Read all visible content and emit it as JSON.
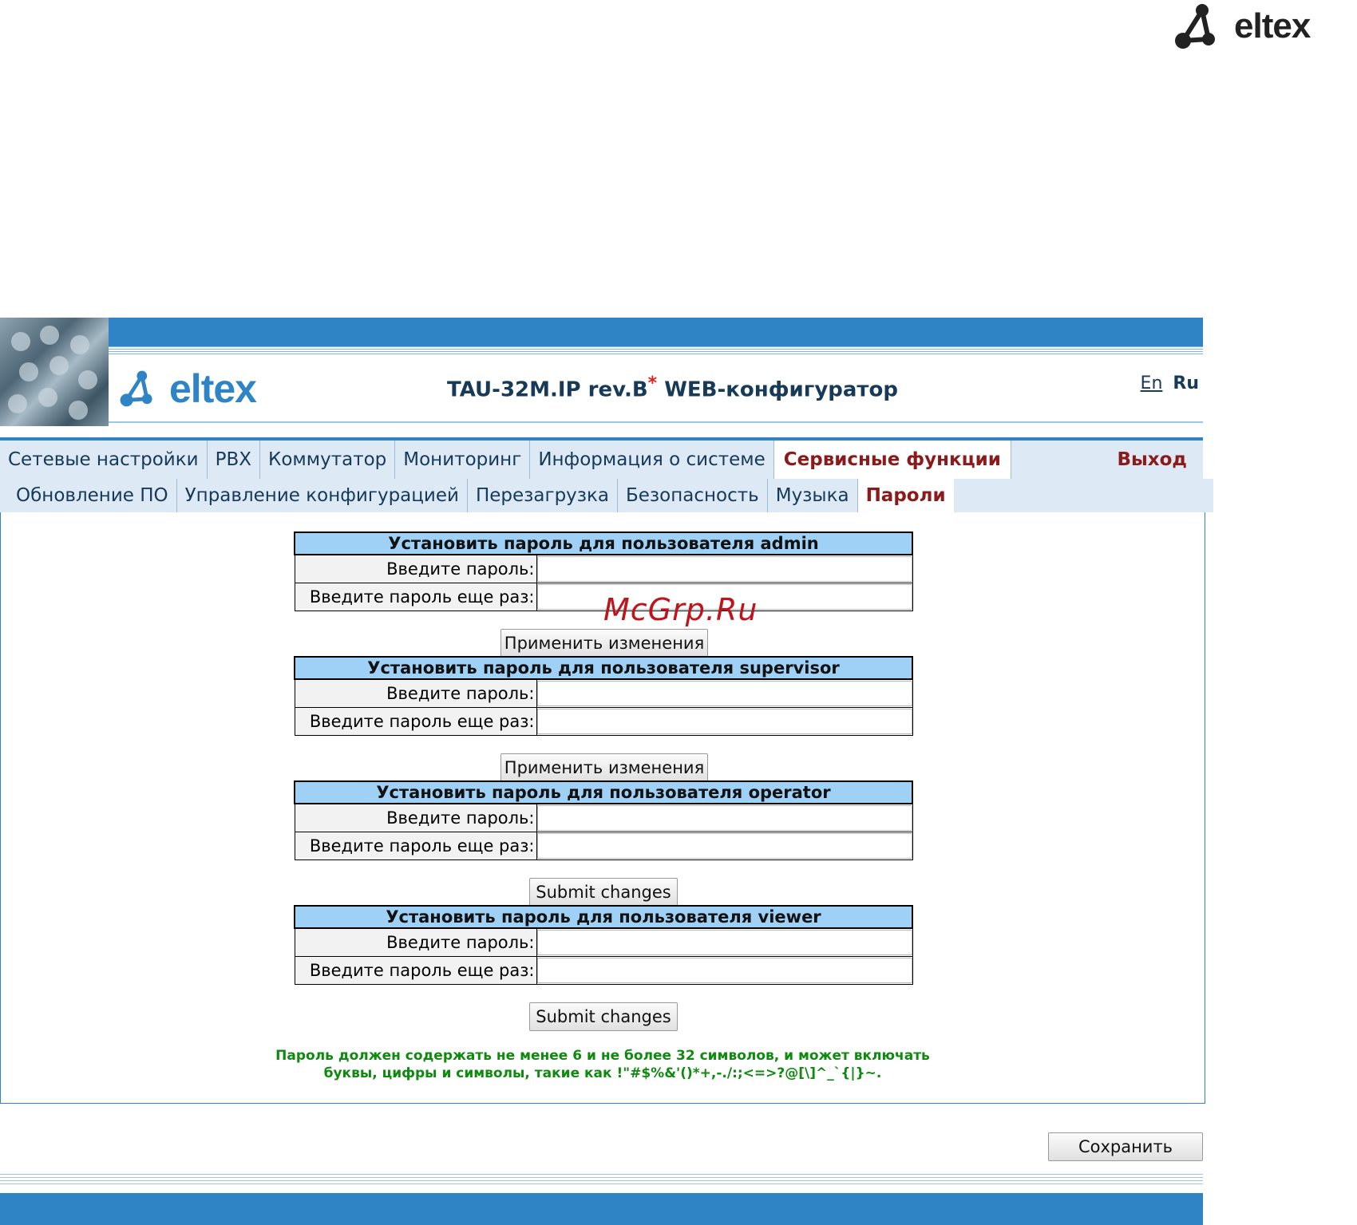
{
  "brand": {
    "corner_logo_text": "eltex",
    "header_logo_text": "eltex"
  },
  "header": {
    "title": "TAU-32M.IP rev.B",
    "title_mark": "*",
    "title_suffix": " WEB-конфигуратор",
    "lang_en": "En",
    "lang_ru": "Ru"
  },
  "menu": {
    "items": [
      {
        "label": "Сетевые настройки"
      },
      {
        "label": "PBX"
      },
      {
        "label": "Коммутатор"
      },
      {
        "label": "Мониторинг"
      },
      {
        "label": "Информация о системе"
      },
      {
        "label": "Сервисные функции"
      }
    ],
    "exit_label": "Выход"
  },
  "submenu": {
    "items": [
      {
        "label": "Обновление ПО"
      },
      {
        "label": "Управление конфигурацией"
      },
      {
        "label": "Перезагрузка"
      },
      {
        "label": "Безопасность"
      },
      {
        "label": "Музыка"
      },
      {
        "label": "Пароли"
      }
    ]
  },
  "sections": [
    {
      "title": "Установить пароль для пользователя admin",
      "enter_label": "Введите пароль:",
      "repeat_label": "Введите пароль еще раз:",
      "button": "Применить изменения"
    },
    {
      "title": "Установить пароль для пользователя supervisor",
      "enter_label": "Введите пароль:",
      "repeat_label": "Введите пароль еще раз:",
      "button": "Применить изменения"
    },
    {
      "title": "Установить пароль для пользователя operator",
      "enter_label": "Введите пароль:",
      "repeat_label": "Введите пароль еще раз:",
      "button": "Submit changes"
    },
    {
      "title": "Установить пароль для пользователя viewer",
      "enter_label": "Введите пароль:",
      "repeat_label": "Введите пароль еще раз:",
      "button": "Submit changes"
    }
  ],
  "note": {
    "line1": "Пароль должен содержать не менее 6 и не более 32 символов, и может включать",
    "line2": "буквы, цифры и символы, такие как !\"#$%&'()*+,-./:;<=>?@[\\]^_`{|}~."
  },
  "save_button": "Сохранить",
  "watermark": "McGrp.Ru",
  "colors": {
    "accent": "#2f84c6",
    "active_tab": "#8b1a1a",
    "table_header": "#9fd0f5",
    "note": "#0e8a0e"
  }
}
